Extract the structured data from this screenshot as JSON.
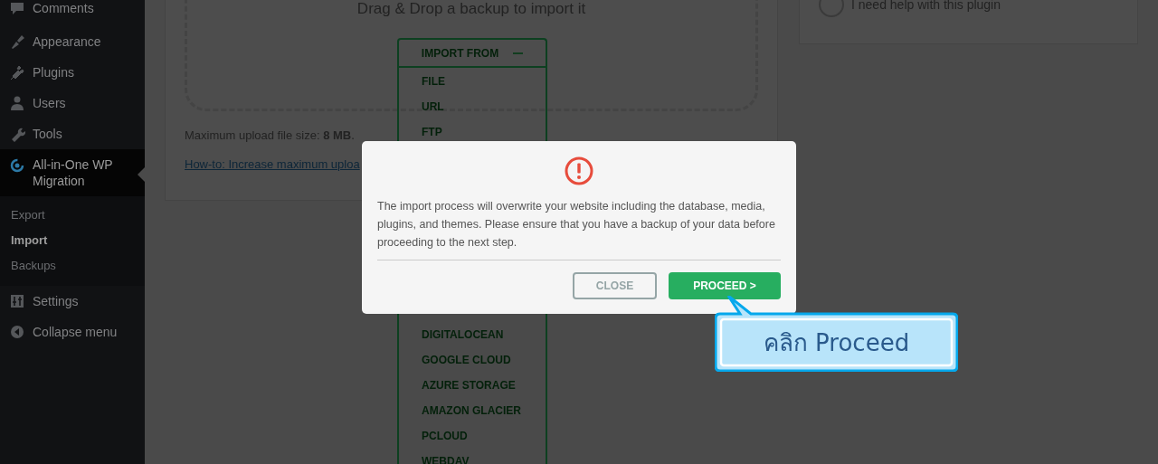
{
  "sidebar": {
    "items": [
      {
        "label": "Comments",
        "selected": false
      },
      {
        "label": "Appearance",
        "selected": false
      },
      {
        "label": "Plugins",
        "selected": false
      },
      {
        "label": "Users",
        "selected": false
      },
      {
        "label": "Tools",
        "selected": false
      },
      {
        "label": "All-in-One WP Migration",
        "selected": true,
        "children": [
          {
            "label": "Export",
            "selected": false
          },
          {
            "label": "Import",
            "selected": true
          },
          {
            "label": "Backups",
            "selected": false
          }
        ]
      },
      {
        "label": "Settings",
        "selected": false
      },
      {
        "label": "Collapse menu",
        "selected": false
      }
    ]
  },
  "import_panel": {
    "drop_hint": "Drag & Drop a backup to import it",
    "import_menu": {
      "title": "IMPORT FROM",
      "expanded": true,
      "items_above_dialog": [
        "FILE",
        "URL",
        "FTP"
      ],
      "items_below_dialog": [
        "DIGITALOCEAN",
        "GOOGLE CLOUD",
        "AZURE STORAGE",
        "AMAZON GLACIER",
        "PCLOUD",
        "WEBDAV"
      ]
    },
    "max_upload": "Maximum upload file size: **8 MB**.",
    "howto_link": "How-to: Increase maximum uploa"
  },
  "help_panel": {
    "option": "I need help with this plugin",
    "selected": false
  },
  "dialog": {
    "message": "The import process will overwrite your website including the database, media, plugins, and themes. Please ensure that you have a backup of your data before proceeding to the next step.",
    "buttons": [
      {
        "label": "CLOSE",
        "kind": "secondary"
      },
      {
        "label": "PROCEED >",
        "kind": "primary"
      }
    ]
  },
  "callout": {
    "text": "คลิก Proceed"
  }
}
